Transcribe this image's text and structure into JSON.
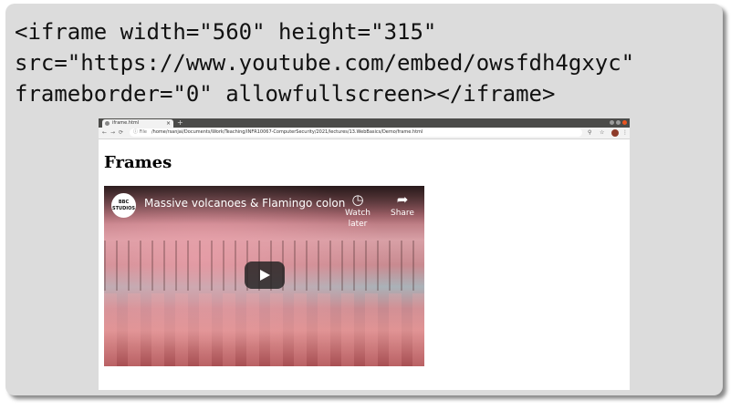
{
  "code": {
    "lines": [
      "<iframe width=\"560\" height=\"315\"",
      "src=\"https://www.youtube.com/embed/owsfdh4gxyc\"",
      "frameborder=\"0\" allowfullscreen></iframe>"
    ]
  },
  "browser": {
    "tab_title": "iframe.html",
    "tab_close": "×",
    "new_tab": "+",
    "nav": {
      "back": "←",
      "forward": "→",
      "reload": "⟳"
    },
    "url": {
      "info": "ⓘ File",
      "text": "/home/rsanjai/Documents/Work/Teaching/INFR10067-ComputerSecurity/2021/lectures/13.WebBasics/Demo/frame.html"
    },
    "toolbar_icons": {
      "zoom": "⚲",
      "star": "☆",
      "menu": "⋮"
    },
    "colors": {
      "close": "#e95420",
      "min": "#9b9b9b",
      "max": "#9b9b9b"
    }
  },
  "page": {
    "heading": "Frames",
    "video": {
      "channel_logo_lines": [
        "BBC",
        "STUDIOS"
      ],
      "title": "Massive volcanoes & Flamingo colony -...",
      "watch_later_label": "Watch later",
      "share_label": "Share",
      "watch_later_icon": "◷",
      "share_icon": "➦"
    }
  }
}
